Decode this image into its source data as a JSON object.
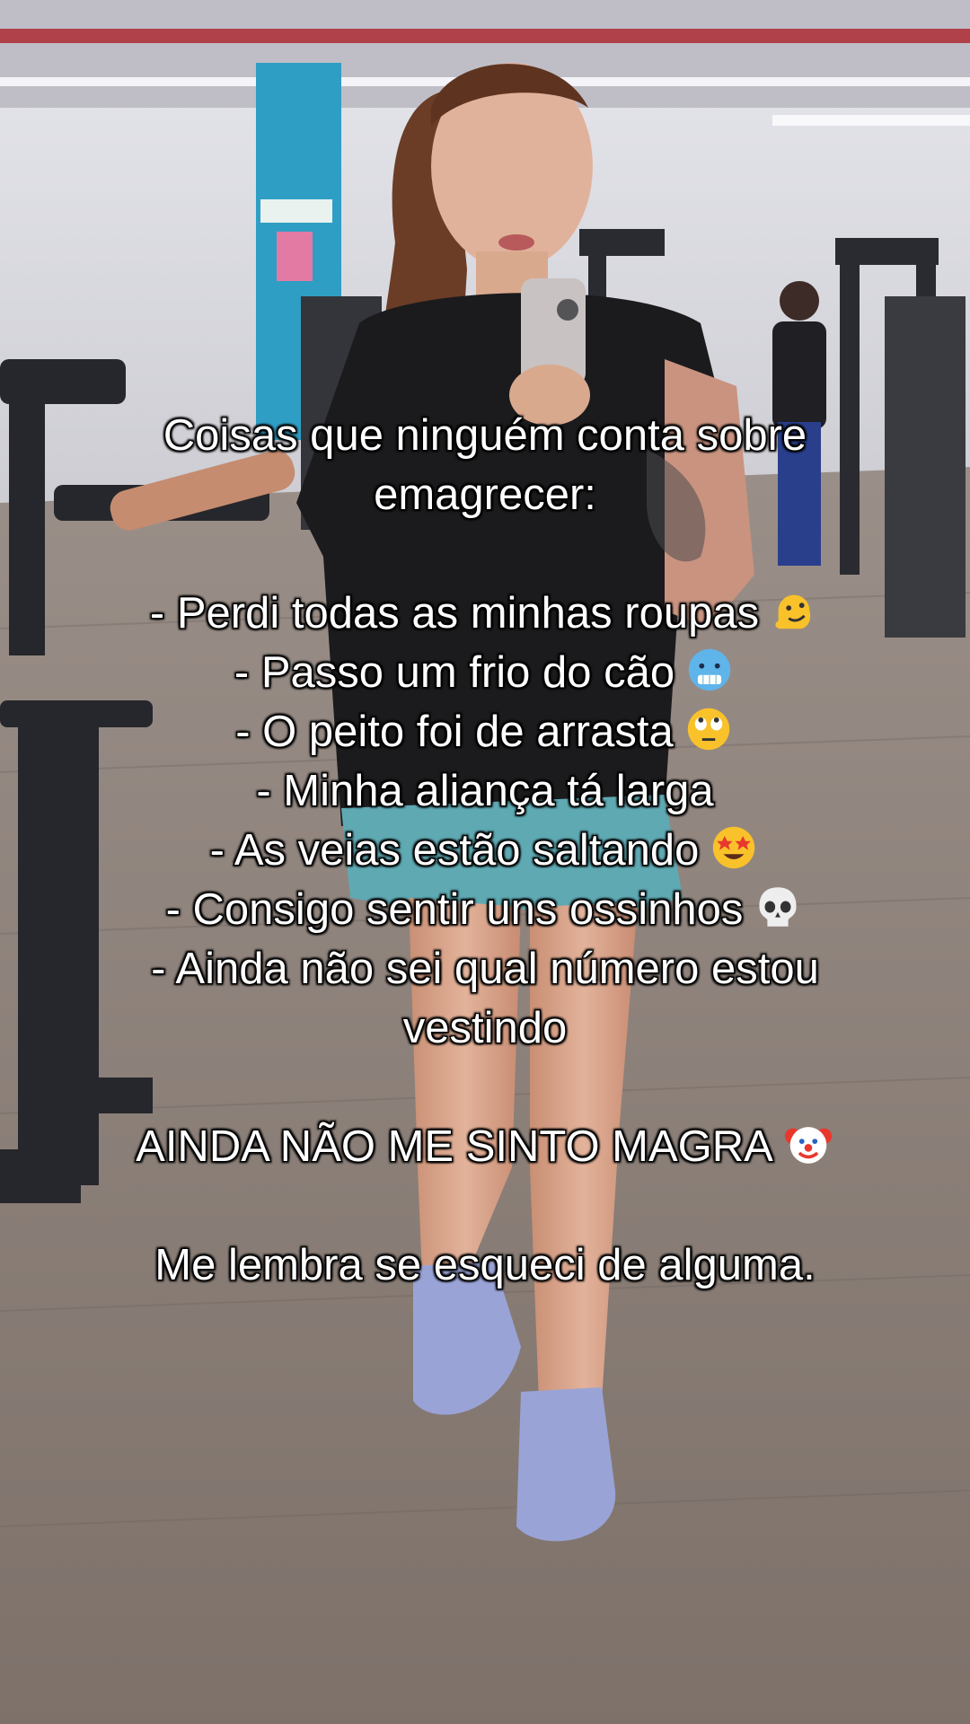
{
  "caption": {
    "lines": [
      {
        "text": "Coisas que ninguém conta sobre",
        "emoji": ""
      },
      {
        "text": "emagrecer:",
        "emoji": ""
      },
      {
        "text": "",
        "emoji": ""
      },
      {
        "text": "- Perdi todas as minhas roupas",
        "emoji": "melting-face-icon"
      },
      {
        "text": "- Passo um frio do cão",
        "emoji": "cold-face-icon"
      },
      {
        "text": "- O peito foi de arrasta",
        "emoji": "eye-roll-face-icon"
      },
      {
        "text": "- Minha aliança tá larga",
        "emoji": ""
      },
      {
        "text": "- As veias estão saltando",
        "emoji": "star-struck-icon"
      },
      {
        "text": "- Consigo sentir uns ossinhos",
        "emoji": "skull-icon"
      },
      {
        "text": "- Ainda não sei qual número estou",
        "emoji": ""
      },
      {
        "text": "vestindo",
        "emoji": ""
      },
      {
        "text": "",
        "emoji": ""
      },
      {
        "text": "AINDA NÃO ME SINTO MAGRA",
        "emoji": "clown-face-icon"
      },
      {
        "text": "",
        "emoji": ""
      },
      {
        "text": "Me lembra se esqueci de alguma.",
        "emoji": ""
      }
    ]
  },
  "colors": {
    "caption_text": "#ffffff",
    "caption_outline": "#000000",
    "wall": "#d6d6dc",
    "floor": "#8c8078",
    "pillar": "#2f9ec4",
    "shirt": "#1b1b1d",
    "shorts": "#5fa9b3",
    "sneakers": "#9aa3d6",
    "hair": "#6b3d26",
    "skin": "#d9a98e"
  }
}
